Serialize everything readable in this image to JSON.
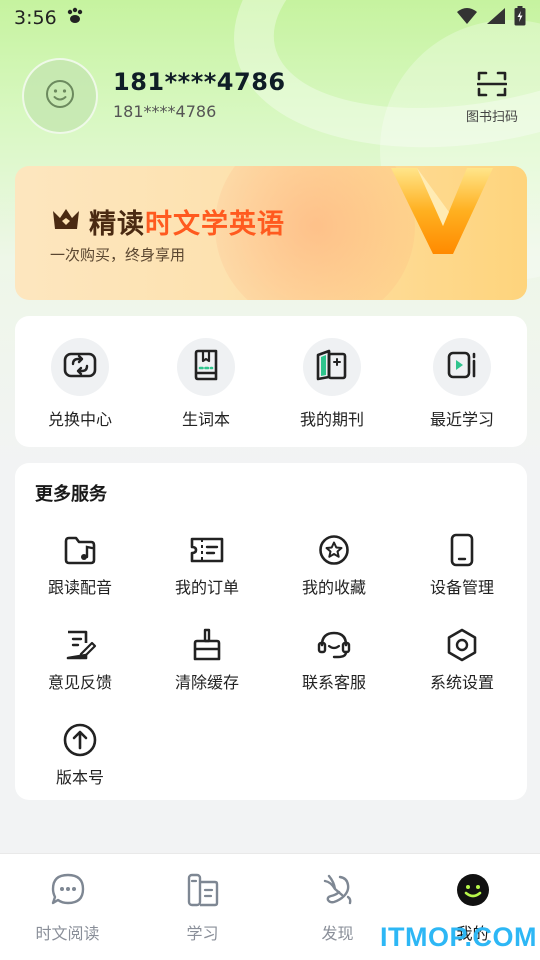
{
  "status_bar": {
    "time": "3:56"
  },
  "profile": {
    "display_name": "181****4786",
    "account": "181****4786",
    "scan_label": "图书扫码"
  },
  "vip_banner": {
    "title_part1": "精读",
    "title_part2": "时文学英语",
    "subtitle": "一次购买，终身享用",
    "colors": {
      "title_dark": "#4a2a12",
      "title_accent": "#ff5a1f"
    }
  },
  "quick_actions": [
    {
      "label": "兑换中心",
      "icon": "exchange-icon"
    },
    {
      "label": "生词本",
      "icon": "vocabulary-book-icon"
    },
    {
      "label": "我的期刊",
      "icon": "journal-icon"
    },
    {
      "label": "最近学习",
      "icon": "recent-video-icon"
    }
  ],
  "services": {
    "title": "更多服务",
    "items": [
      {
        "label": "跟读配音",
        "icon": "folder-music-icon"
      },
      {
        "label": "我的订单",
        "icon": "order-ticket-icon"
      },
      {
        "label": "我的收藏",
        "icon": "star-circle-icon"
      },
      {
        "label": "设备管理",
        "icon": "phone-icon"
      },
      {
        "label": "意见反馈",
        "icon": "feedback-icon"
      },
      {
        "label": "清除缓存",
        "icon": "broom-icon"
      },
      {
        "label": "联系客服",
        "icon": "headset-icon"
      },
      {
        "label": "系统设置",
        "icon": "settings-hexagon-icon"
      },
      {
        "label": "版本号",
        "icon": "upload-circle-icon"
      }
    ]
  },
  "bottom_nav": {
    "tabs": [
      {
        "label": "时文阅读",
        "icon": "chat-bubble-icon",
        "active": false
      },
      {
        "label": "学习",
        "icon": "study-book-icon",
        "active": false
      },
      {
        "label": "发现",
        "icon": "discover-icon",
        "active": false
      },
      {
        "label": "我的",
        "icon": "smiley-profile-icon",
        "active": true
      }
    ]
  },
  "watermark": "ITMOP.COM"
}
